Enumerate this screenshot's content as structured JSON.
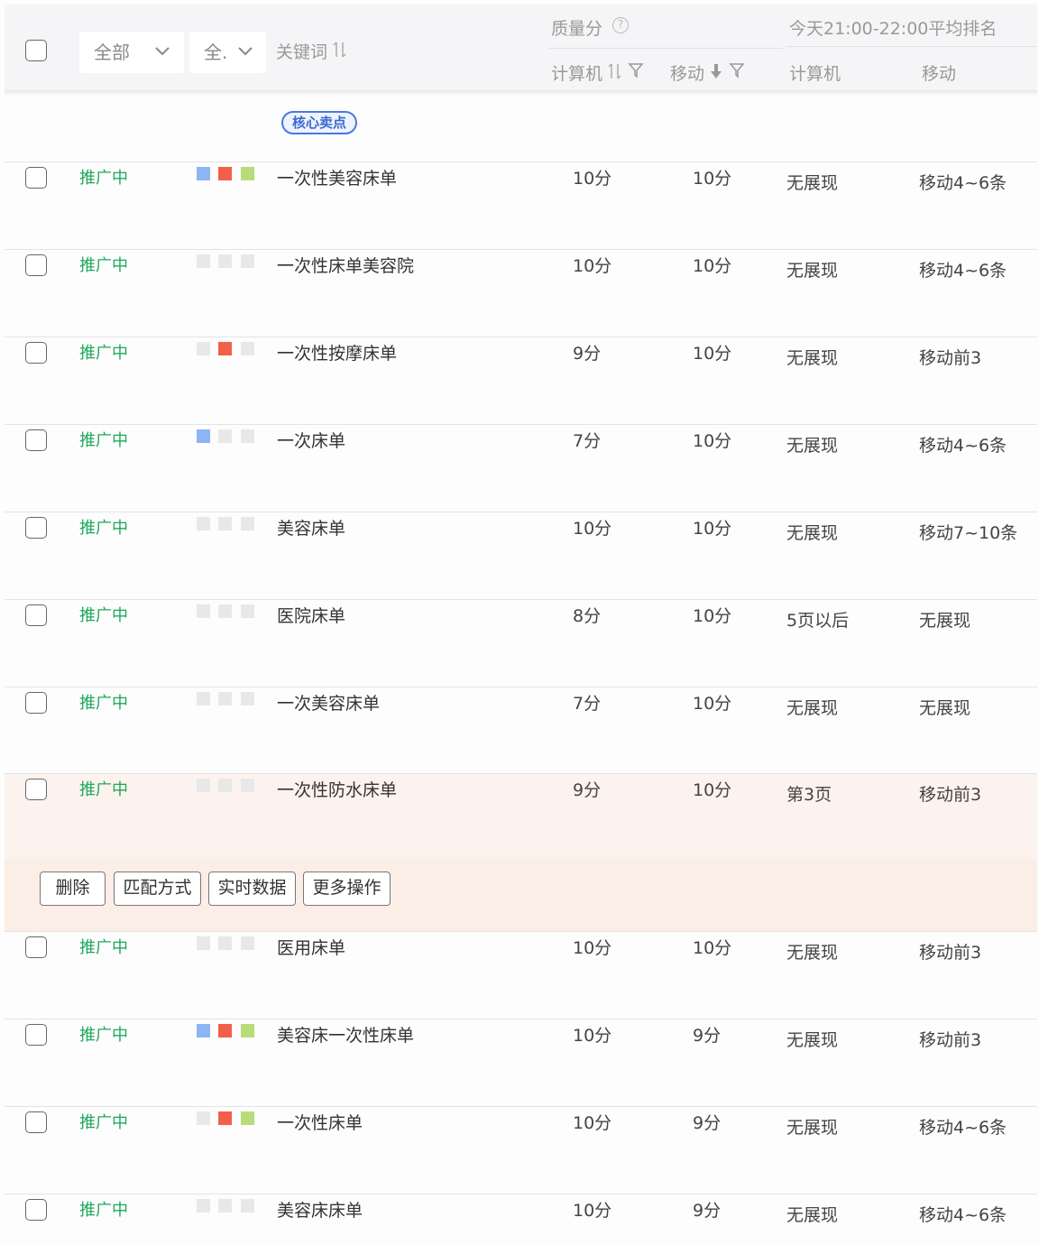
{
  "header": {
    "filter_all": "全部",
    "filter_short": "全.",
    "keyword_col": "关键词",
    "quality_title": "质量分",
    "quality_pc": "计算机",
    "quality_mobile": "移动",
    "rank_title": "今天21:00-22:00平均排名",
    "rank_pc": "计算机",
    "rank_mobile": "移动",
    "help_glyph": "?"
  },
  "partial_row": {
    "tag": "核心卖点"
  },
  "rows": [
    {
      "status": "推广中",
      "colors": [
        "blue",
        "red",
        "green"
      ],
      "keyword": "一次性美容床单",
      "pc": "10分",
      "mobile": "10分",
      "rank_pc": "无展现",
      "rank_mobile": "移动4~6条"
    },
    {
      "status": "推广中",
      "colors": [
        "gray",
        "gray",
        "gray"
      ],
      "keyword": "一次性床单美容院",
      "pc": "10分",
      "mobile": "10分",
      "rank_pc": "无展现",
      "rank_mobile": "移动4~6条"
    },
    {
      "status": "推广中",
      "colors": [
        "gray",
        "red",
        "gray"
      ],
      "keyword": "一次性按摩床单",
      "pc": "9分",
      "mobile": "10分",
      "rank_pc": "无展现",
      "rank_mobile": "移动前3"
    },
    {
      "status": "推广中",
      "colors": [
        "blue",
        "gray",
        "gray"
      ],
      "keyword": "一次床单",
      "pc": "7分",
      "mobile": "10分",
      "rank_pc": "无展现",
      "rank_mobile": "移动4~6条"
    },
    {
      "status": "推广中",
      "colors": [
        "gray",
        "gray",
        "gray"
      ],
      "keyword": "美容床单",
      "pc": "10分",
      "mobile": "10分",
      "rank_pc": "无展现",
      "rank_mobile": "移动7~10条"
    },
    {
      "status": "推广中",
      "colors": [
        "gray",
        "gray",
        "gray"
      ],
      "keyword": "医院床单",
      "pc": "8分",
      "mobile": "10分",
      "rank_pc": "5页以后",
      "rank_mobile": "无展现"
    },
    {
      "status": "推广中",
      "colors": [
        "gray",
        "gray",
        "gray"
      ],
      "keyword": "一次美容床单",
      "pc": "7分",
      "mobile": "10分",
      "rank_pc": "无展现",
      "rank_mobile": "无展现"
    },
    {
      "status": "推广中",
      "colors": [
        "gray",
        "gray",
        "gray"
      ],
      "keyword": "一次性防水床单",
      "pc": "9分",
      "mobile": "10分",
      "rank_pc": "第3页",
      "rank_mobile": "移动前3"
    },
    {
      "status": "推广中",
      "colors": [
        "gray",
        "gray",
        "gray"
      ],
      "keyword": "医用床单",
      "pc": "10分",
      "mobile": "10分",
      "rank_pc": "无展现",
      "rank_mobile": "移动前3"
    },
    {
      "status": "推广中",
      "colors": [
        "blue",
        "red",
        "green"
      ],
      "keyword": "美容床一次性床单",
      "pc": "10分",
      "mobile": "9分",
      "rank_pc": "无展现",
      "rank_mobile": "移动前3"
    },
    {
      "status": "推广中",
      "colors": [
        "gray",
        "red",
        "green"
      ],
      "keyword": "一次性床单",
      "pc": "10分",
      "mobile": "9分",
      "rank_pc": "无展现",
      "rank_mobile": "移动4~6条"
    },
    {
      "status": "推广中",
      "colors": [
        "gray",
        "gray",
        "gray"
      ],
      "keyword": "美容床床单",
      "pc": "10分",
      "mobile": "9分",
      "rank_pc": "无展现",
      "rank_mobile": "移动4~6条"
    }
  ],
  "actions": {
    "delete": "删除",
    "match_type": "匹配方式",
    "realtime": "实时数据",
    "more": "更多操作"
  },
  "colors": {
    "status_green": "#1fa85a",
    "blue": "#8db5f5",
    "red": "#f2604a",
    "green": "#b9dc7a",
    "gray": "#e8e8e8",
    "highlight": "#fdf3ee"
  }
}
